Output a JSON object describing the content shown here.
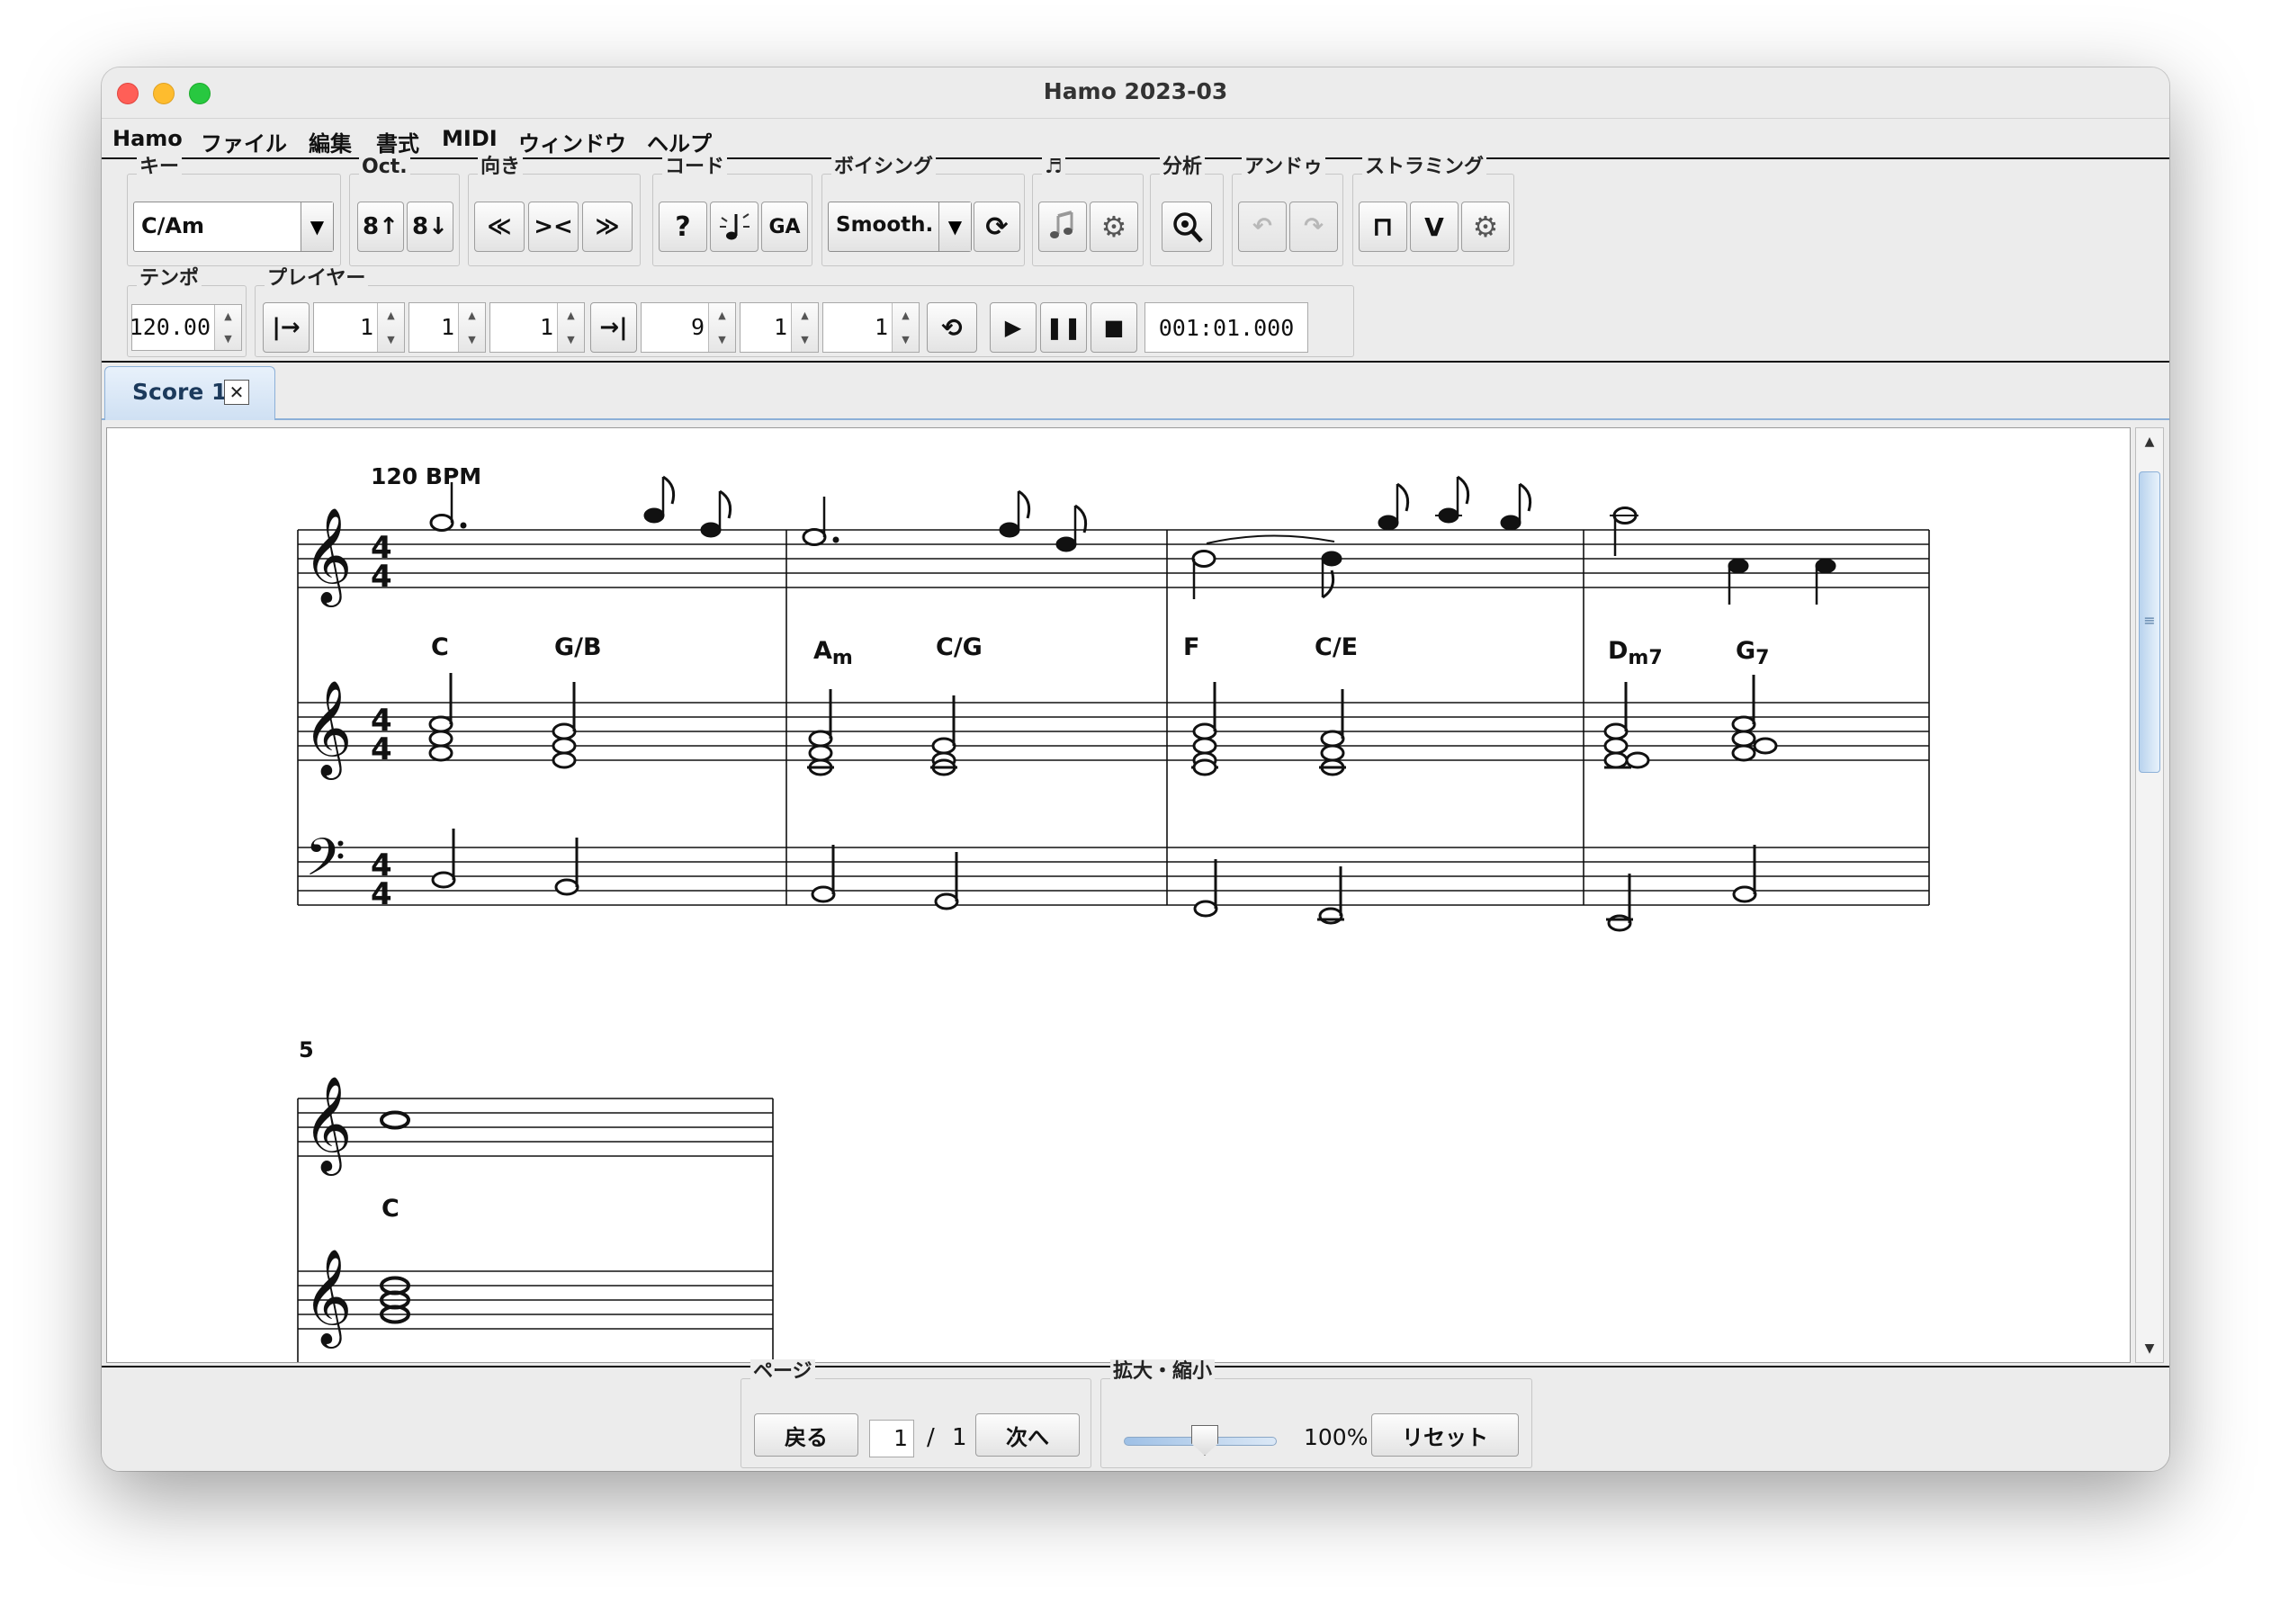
{
  "window": {
    "title": "Hamo 2023-03"
  },
  "menu": [
    "Hamo",
    "ファイル",
    "編集",
    "書式",
    "MIDI",
    "ウィンドウ",
    "ヘルプ"
  ],
  "toolbar": {
    "key": {
      "label": "キー",
      "value": "C/Am"
    },
    "octave": {
      "label": "Oct.",
      "up": "8↑",
      "down": "8↓"
    },
    "direction": {
      "label": "向き",
      "left": "≪",
      "center": "><",
      "right": "≫"
    },
    "chord": {
      "label": "コード",
      "ga": "GA"
    },
    "voicing": {
      "label": "ボイシング",
      "value": "Smooth."
    },
    "note_group": {
      "label": "♬"
    },
    "analysis": {
      "label": "分析"
    },
    "undo": {
      "label": "アンドゥ"
    },
    "strumming": {
      "label": "ストラミング",
      "down": "⊓",
      "up": "V"
    },
    "tempo": {
      "label": "テンポ",
      "value": "120.00"
    },
    "player": {
      "label": "プレイヤー",
      "start": [
        "1",
        "1",
        "1"
      ],
      "end": [
        "9",
        "1",
        "1"
      ],
      "time": "001:01.000"
    }
  },
  "tabs": [
    {
      "label": "Score 1"
    }
  ],
  "score": {
    "tempo_mark": "120 BPM",
    "measure_number": "5",
    "chords_row1": [
      {
        "root": "C",
        "sfx": ""
      },
      {
        "root": "G/B",
        "sfx": ""
      },
      {
        "root": "A",
        "sfx": "m"
      },
      {
        "root": "C/G",
        "sfx": ""
      },
      {
        "root": "F",
        "sfx": ""
      },
      {
        "root": "C/E",
        "sfx": ""
      },
      {
        "root": "D",
        "sfx": "m7"
      },
      {
        "root": "G",
        "sfx": "7"
      }
    ],
    "chords_row2": [
      {
        "root": "C",
        "sfx": ""
      }
    ],
    "time_sig": "4"
  },
  "bottom": {
    "page": {
      "label": "ページ",
      "back": "戻る",
      "current": "1",
      "sep": "/",
      "total": "1",
      "next": "次へ"
    },
    "zoom": {
      "label": "拡大・縮小",
      "value": "100%",
      "reset": "リセット",
      "level": 0.5
    }
  }
}
